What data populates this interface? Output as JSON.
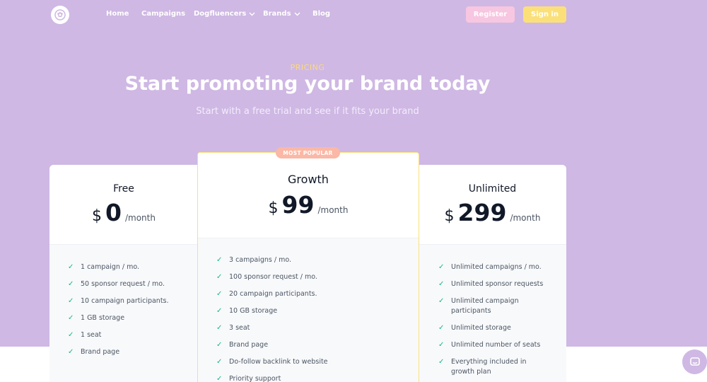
{
  "nav": {
    "items": [
      {
        "label": "Home",
        "dropdown": false
      },
      {
        "label": "Campaigns",
        "dropdown": false
      },
      {
        "label": "Dogfluencers",
        "dropdown": true
      },
      {
        "label": "Brands",
        "dropdown": true
      },
      {
        "label": "Blog",
        "dropdown": false
      }
    ],
    "register_label": "Register",
    "signin_label": "Sign in"
  },
  "hero": {
    "eyebrow": "PRICING",
    "title": "Start promoting your brand today",
    "subtitle": "Start with a free trial and see if it fits your brand"
  },
  "plans": [
    {
      "name": "Free",
      "currency": "$",
      "price": "0",
      "period": "/month",
      "features": [
        "1 campaign / mo.",
        "50 sponsor request / mo.",
        "10 campaign participants.",
        "1 GB storage",
        "1 seat",
        "Brand page"
      ]
    },
    {
      "name": "Growth",
      "currency": "$",
      "price": "99",
      "period": "/month",
      "badge": "MOST POPULAR",
      "features": [
        "3 campaigns / mo.",
        "100 sponsor request / mo.",
        "20 campaign participants.",
        "10 GB storage",
        "3 seat",
        "Brand page",
        "Do-follow backlink to website",
        "Priority support"
      ]
    },
    {
      "name": "Unlimited",
      "currency": "$",
      "price": "299",
      "period": "/month",
      "features": [
        "Unlimited campaigns / mo.",
        "Unlimited sponsor requests",
        "Unlimited campaign participants",
        "Unlimited storage",
        "Unlimited number of seats",
        "Everything included in growth plan"
      ]
    }
  ],
  "colors": {
    "hero_bg": "#cfb8e4",
    "register_bg": "#f7c6e0",
    "signin_bg": "#fbe07a",
    "badge_bg": "#fbb8a6",
    "check": "#10b981"
  },
  "icons": {
    "logo": "brand-logo-icon",
    "dropdown": "chevron-down-icon",
    "feature": "check-icon",
    "chat": "chat-bubble-icon"
  }
}
